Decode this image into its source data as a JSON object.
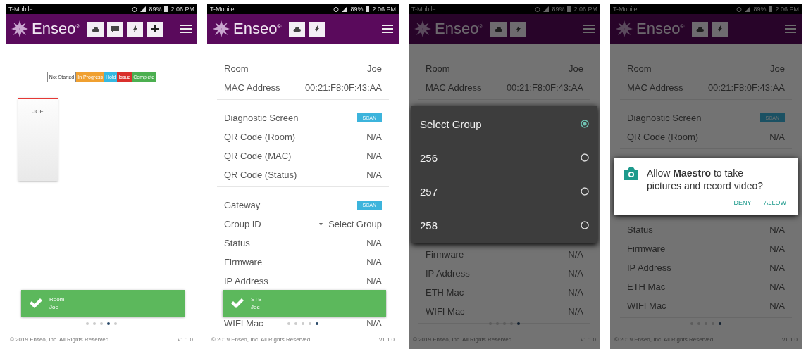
{
  "screens": [
    {
      "status_bar": {
        "carrier": "T-Mobile",
        "battery": "89%",
        "time": "2:06 PM"
      },
      "header": {
        "logo": "Enseo$^{®}$",
        "buttons": [
          {
            "kind": "cloud"
          },
          {
            "kind": "message"
          },
          {
            "kind": "bolt"
          },
          {
            "kind": "plus"
          }
        ]
      },
      "dimmed": false,
      "content": [
        {
          "kind": "legend",
          "chips": [
            {
              "label": "Not Started",
              "color": "#ffffff"
            },
            {
              "label": "In Progress",
              "color": "#f0a030"
            },
            {
              "label": "Hold",
              "color": "#35b8e0"
            },
            {
              "label": "Issue",
              "color": "#d9302c"
            },
            {
              "label": "Complete",
              "color": "#4caf50"
            }
          ]
        },
        {
          "kind": "board",
          "cards": [
            {
              "label": "JOE",
              "color": "#e53935"
            }
          ]
        }
      ],
      "toast": {
        "title": "Room",
        "subtitle": "Joe"
      },
      "page_dots": [
        {
          "selected": false
        },
        {
          "selected": false
        },
        {
          "selected": false
        },
        {
          "selected": true
        },
        {
          "selected": false
        }
      ],
      "footer": {
        "copyright": "© 2019 Enseo, Inc. All Rights Reserved",
        "version": "v1.1.0"
      }
    },
    {
      "status_bar": {
        "carrier": "T-Mobile",
        "battery": "89%",
        "time": "2:06 PM"
      },
      "header": {
        "logo": "Enseo$^{®}$",
        "buttons": [
          {
            "kind": "cloud"
          },
          {
            "kind": "bolt"
          }
        ]
      },
      "dimmed": false,
      "content": [
        {
          "kind": "section",
          "rows": [
            {
              "kind": "text",
              "label": "Room",
              "value": "Joe"
            },
            {
              "kind": "text",
              "label": "MAC Address",
              "value": "00:21:F8:0F:43:AA"
            }
          ]
        },
        {
          "kind": "section",
          "rows": [
            {
              "kind": "scan",
              "label": "Diagnostic Screen",
              "value": "SCAN"
            },
            {
              "kind": "text",
              "label": "QR Code (Room)",
              "value": "N/A"
            },
            {
              "kind": "text",
              "label": "QR Code (MAC)",
              "value": "N/A"
            },
            {
              "kind": "text",
              "label": "QR Code (Status)",
              "value": "N/A"
            }
          ]
        },
        {
          "kind": "section",
          "rows": [
            {
              "kind": "scan",
              "label": "Gateway",
              "value": "SCAN"
            },
            {
              "kind": "select",
              "label": "Group ID",
              "value": "Select Group"
            },
            {
              "kind": "text",
              "label": "Status",
              "value": "N/A"
            },
            {
              "kind": "text",
              "label": "Firmware",
              "value": "N/A"
            },
            {
              "kind": "text",
              "label": "IP Address",
              "value": "N/A"
            },
            {
              "kind": "gap"
            },
            {
              "kind": "text",
              "label": "WIFI Mac",
              "value": "N/A"
            }
          ]
        }
      ],
      "toast": {
        "title": "STB",
        "subtitle": "Joe"
      },
      "page_dots": [
        {
          "selected": false
        },
        {
          "selected": false
        },
        {
          "selected": false
        },
        {
          "selected": false
        },
        {
          "selected": true
        }
      ],
      "footer": {
        "copyright": "© 2019 Enseo, Inc. All Rights Reserved",
        "version": "v1.1.0"
      }
    },
    {
      "status_bar": {
        "carrier": "T-Mobile",
        "battery": "89%",
        "time": "2:06 PM"
      },
      "header": {
        "logo": "Enseo$^{®}$",
        "buttons": [
          {
            "kind": "cloud"
          },
          {
            "kind": "bolt"
          }
        ]
      },
      "dimmed": true,
      "content": [
        {
          "kind": "section",
          "rows": [
            {
              "kind": "text",
              "label": "Room",
              "value": "Joe"
            },
            {
              "kind": "text",
              "label": "MAC Address",
              "value": "00:21:F8:0F:43:AA"
            }
          ]
        },
        {
          "kind": "select_dialog",
          "options": [
            {
              "label": "Select Group",
              "selected": true
            },
            {
              "label": "256",
              "selected": false
            },
            {
              "label": "257",
              "selected": false
            },
            {
              "label": "258",
              "selected": false
            }
          ]
        },
        {
          "kind": "section",
          "rows": [
            {
              "kind": "text",
              "label": "Firmware",
              "value": "N/A"
            },
            {
              "kind": "text",
              "label": "IP Address",
              "value": "N/A"
            },
            {
              "kind": "text",
              "label": "ETH Mac",
              "value": "N/A"
            },
            {
              "kind": "text",
              "label": "WIFI Mac",
              "value": "N/A"
            }
          ]
        }
      ],
      "page_dots": [
        {
          "selected": false
        },
        {
          "selected": false
        },
        {
          "selected": false
        },
        {
          "selected": false
        },
        {
          "selected": true
        }
      ],
      "footer": {
        "copyright": "© 2019 Enseo, Inc. All Rights Reserved",
        "version": "v1.1.0"
      }
    },
    {
      "status_bar": {
        "carrier": "T-Mobile",
        "battery": "89%",
        "time": "2:06 PM"
      },
      "header": {
        "logo": "Enseo$^{®}$",
        "buttons": [
          {
            "kind": "cloud"
          },
          {
            "kind": "bolt"
          }
        ]
      },
      "dimmed": true,
      "content": [
        {
          "kind": "section",
          "rows": [
            {
              "kind": "text",
              "label": "Room",
              "value": "Joe"
            },
            {
              "kind": "text",
              "label": "MAC Address",
              "value": "00:21:F8:0F:43:AA"
            }
          ]
        },
        {
          "kind": "section",
          "rows": [
            {
              "kind": "scan",
              "label": "Diagnostic Screen",
              "value": "SCAN"
            },
            {
              "kind": "text",
              "label": "QR Code (Room)",
              "value": "N/A"
            }
          ]
        },
        {
          "kind": "permission_dialog",
          "message": "Allow **Maestro** to take pictures and record video?",
          "actions": [
            "DENY",
            "ALLOW"
          ]
        },
        {
          "kind": "section",
          "rows": [
            {
              "kind": "text",
              "label": "Status",
              "value": "N/A"
            },
            {
              "kind": "text",
              "label": "Firmware",
              "value": "N/A"
            },
            {
              "kind": "text",
              "label": "IP Address",
              "value": "N/A"
            },
            {
              "kind": "text",
              "label": "ETH Mac",
              "value": "N/A"
            },
            {
              "kind": "text",
              "label": "WIFI Mac",
              "value": "N/A"
            }
          ]
        }
      ],
      "page_dots": [
        {
          "selected": false
        },
        {
          "selected": false
        },
        {
          "selected": false
        },
        {
          "selected": false
        },
        {
          "selected": true
        }
      ],
      "footer": {
        "copyright": "© 2019 Enseo, Inc. All Rights Reserved",
        "version": "v1.1.0"
      }
    }
  ]
}
